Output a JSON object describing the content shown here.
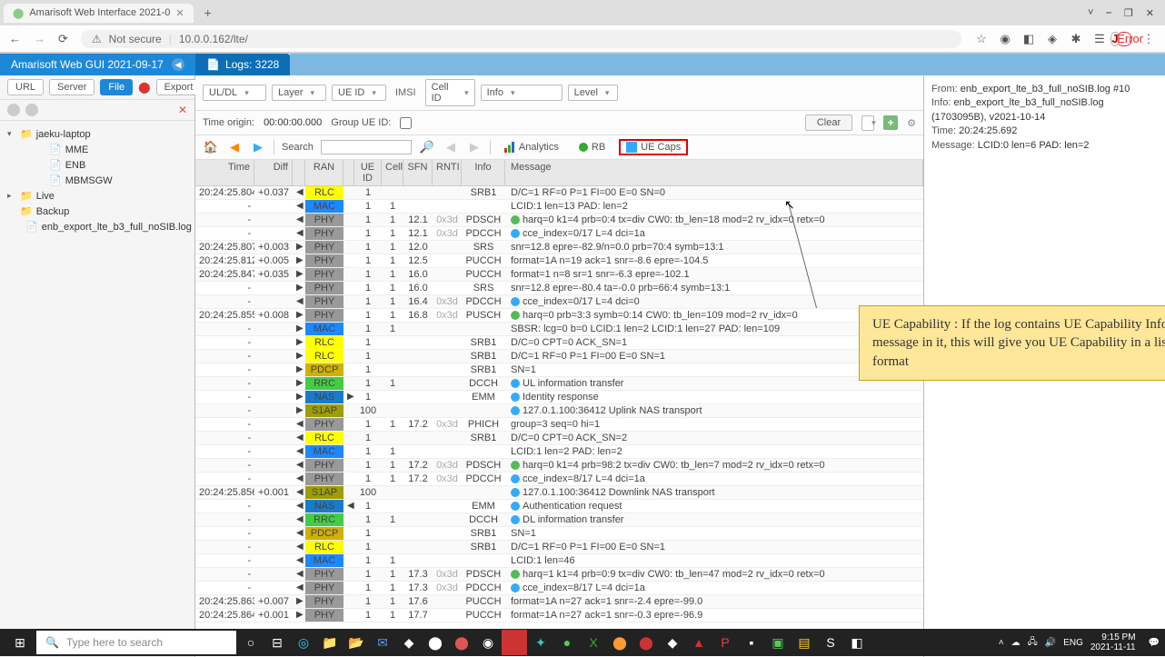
{
  "browser": {
    "tab_title": "Amarisoft Web Interface 2021-0",
    "not_secure": "Not secure",
    "url": "10.0.0.162/lte/",
    "error_label": "Error",
    "win": {
      "min": "⎯",
      "max": "❐",
      "close": "✕",
      "down": "˅"
    }
  },
  "app": {
    "title": "Amarisoft Web GUI 2021-09-17",
    "logs_tab": "Logs: 3228"
  },
  "sidebar": {
    "btns": {
      "url": "URL",
      "server": "Server",
      "file": "File",
      "export": "Export"
    },
    "tree": [
      {
        "toggle": "▾",
        "label": "jaeku-laptop",
        "indent": 0,
        "icon": "folder"
      },
      {
        "toggle": "",
        "label": "MME",
        "indent": 2,
        "icon": "file"
      },
      {
        "toggle": "",
        "label": "ENB",
        "indent": 2,
        "icon": "file"
      },
      {
        "toggle": "",
        "label": "MBMSGW",
        "indent": 2,
        "icon": "file"
      },
      {
        "toggle": "▸",
        "label": "Live",
        "indent": 0,
        "icon": "folder"
      },
      {
        "toggle": "",
        "label": "Backup",
        "indent": 0,
        "icon": "folder"
      },
      {
        "toggle": "",
        "label": "enb_export_lte_b3_full_noSIB.log",
        "indent": 1,
        "icon": "file",
        "check": true
      }
    ]
  },
  "filters": {
    "uldl": "UL/DL",
    "layer": "Layer",
    "ueid": "UE ID",
    "imsi": "IMSI",
    "cellid": "Cell ID",
    "info": "Info",
    "level": "Level",
    "time_origin_lbl": "Time origin:",
    "time_origin_val": "00:00:00.000",
    "group_lbl": "Group UE ID:",
    "clear": "Clear",
    "search_lbl": "Search",
    "analytics_lbl": "Analytics",
    "rb_lbl": "RB",
    "uecaps_lbl": "UE Caps"
  },
  "columns": {
    "time": "Time",
    "diff": "Diff",
    "ran": "RAN",
    "ueid": "UE ID",
    "cell": "Cell",
    "sfn": "SFN",
    "rnti": "RNTI",
    "info": "Info",
    "msg": "Message"
  },
  "rows": [
    {
      "time": "20:24:25.804",
      "diff": "+0.037",
      "dir": "◀",
      "ran": "RLC",
      "ueid": "1",
      "cell": "",
      "sfn": "",
      "rnti": "",
      "info": "SRB1",
      "msg": "D/C=1 RF=0 P=1 FI=00 E=0 SN=0"
    },
    {
      "time": "-",
      "diff": "",
      "dir": "◀",
      "ran": "MAC",
      "ueid": "1",
      "cell": "1",
      "sfn": "",
      "rnti": "",
      "info": "",
      "msg": "LCID:1 len=13 PAD: len=2"
    },
    {
      "time": "-",
      "diff": "",
      "dir": "◀",
      "ran": "PHY",
      "ueid": "1",
      "cell": "1",
      "sfn": "12.1",
      "rnti": "0x3d",
      "info": "PDSCH",
      "msg": "harq=0 k1=4 prb=0:4 tx=div CW0: tb_len=18 mod=2 rv_idx=0 retx=0",
      "dot": "green"
    },
    {
      "time": "-",
      "diff": "",
      "dir": "◀",
      "ran": "PHY",
      "ueid": "1",
      "cell": "1",
      "sfn": "12.1",
      "rnti": "0x3d",
      "info": "PDCCH",
      "msg": "cce_index=0/17 L=4 dci=1a",
      "dot": "blue"
    },
    {
      "time": "20:24:25.807",
      "diff": "+0.003",
      "dir": "▶",
      "ran": "PHY",
      "ueid": "1",
      "cell": "1",
      "sfn": "12.0",
      "rnti": "",
      "info": "SRS",
      "msg": "snr=12.8 epre=-82.9/n=0.0 prb=70:4 symb=13:1"
    },
    {
      "time": "20:24:25.812",
      "diff": "+0.005",
      "dir": "▶",
      "ran": "PHY",
      "ueid": "1",
      "cell": "1",
      "sfn": "12.5",
      "rnti": "",
      "info": "PUCCH",
      "msg": "format=1A n=19 ack=1 snr=-8.6 epre=-104.5"
    },
    {
      "time": "20:24:25.847",
      "diff": "+0.035",
      "dir": "▶",
      "ran": "PHY",
      "ueid": "1",
      "cell": "1",
      "sfn": "16.0",
      "rnti": "",
      "info": "PUCCH",
      "msg": "format=1 n=8 sr=1 snr=-6.3 epre=-102.1"
    },
    {
      "time": "-",
      "diff": "",
      "dir": "▶",
      "ran": "PHY",
      "ueid": "1",
      "cell": "1",
      "sfn": "16.0",
      "rnti": "",
      "info": "SRS",
      "msg": "snr=12.8 epre=-80.4 ta=-0.0 prb=66:4 symb=13:1"
    },
    {
      "time": "-",
      "diff": "",
      "dir": "◀",
      "ran": "PHY",
      "ueid": "1",
      "cell": "1",
      "sfn": "16.4",
      "rnti": "0x3d",
      "info": "PDCCH",
      "msg": "cce_index=0/17 L=4 dci=0",
      "dot": "blue"
    },
    {
      "time": "20:24:25.855",
      "diff": "+0.008",
      "dir": "▶",
      "ran": "PHY",
      "ueid": "1",
      "cell": "1",
      "sfn": "16.8",
      "rnti": "0x3d",
      "info": "PUSCH",
      "msg": "harq=0 prb=3:3 symb=0:14 CW0: tb_len=109 mod=2 rv_idx=0",
      "dot": "green"
    },
    {
      "time": "-",
      "diff": "",
      "dir": "▶",
      "ran": "MAC",
      "ueid": "1",
      "cell": "1",
      "sfn": "",
      "rnti": "",
      "info": "",
      "msg": "SBSR: lcg=0 b=0 LCID:1 len=2 LCID:1 len=27 PAD: len=109"
    },
    {
      "time": "-",
      "diff": "",
      "dir": "▶",
      "ran": "RLC",
      "ueid": "1",
      "cell": "",
      "sfn": "",
      "rnti": "",
      "info": "SRB1",
      "msg": "D/C=0 CPT=0 ACK_SN=1"
    },
    {
      "time": "-",
      "diff": "",
      "dir": "▶",
      "ran": "RLC",
      "ueid": "1",
      "cell": "",
      "sfn": "",
      "rnti": "",
      "info": "SRB1",
      "msg": "D/C=1 RF=0 P=1 FI=00 E=0 SN=1"
    },
    {
      "time": "-",
      "diff": "",
      "dir": "▶",
      "ran": "PDCP",
      "ueid": "1",
      "cell": "",
      "sfn": "",
      "rnti": "",
      "info": "SRB1",
      "msg": "SN=1"
    },
    {
      "time": "-",
      "diff": "",
      "dir": "▶",
      "ran": "RRC",
      "ueid": "1",
      "cell": "1",
      "sfn": "",
      "rnti": "",
      "info": "DCCH",
      "msg": "UL information transfer",
      "dot": "blue"
    },
    {
      "time": "-",
      "diff": "",
      "dir": "▶",
      "ran": "NAS",
      "dir2": "▶",
      "ueid": "1",
      "cell": "",
      "sfn": "",
      "rnti": "",
      "info": "EMM",
      "msg": "Identity response",
      "dot": "blue"
    },
    {
      "time": "-",
      "diff": "",
      "dir": "▶",
      "ran": "S1AP",
      "ueid": "100",
      "cell": "",
      "sfn": "",
      "rnti": "",
      "info": "",
      "msg": "127.0.1.100:36412 Uplink NAS transport",
      "dot": "blue"
    },
    {
      "time": "-",
      "diff": "",
      "dir": "◀",
      "ran": "PHY",
      "ueid": "1",
      "cell": "1",
      "sfn": "17.2",
      "rnti": "0x3d",
      "info": "PHICH",
      "msg": "group=3 seq=0 hi=1"
    },
    {
      "time": "-",
      "diff": "",
      "dir": "◀",
      "ran": "RLC",
      "ueid": "1",
      "cell": "",
      "sfn": "",
      "rnti": "",
      "info": "SRB1",
      "msg": "D/C=0 CPT=0 ACK_SN=2"
    },
    {
      "time": "-",
      "diff": "",
      "dir": "◀",
      "ran": "MAC",
      "ueid": "1",
      "cell": "1",
      "sfn": "",
      "rnti": "",
      "info": "",
      "msg": "LCID:1 len=2 PAD: len=2"
    },
    {
      "time": "-",
      "diff": "",
      "dir": "◀",
      "ran": "PHY",
      "ueid": "1",
      "cell": "1",
      "sfn": "17.2",
      "rnti": "0x3d",
      "info": "PDSCH",
      "msg": "harq=0 k1=4 prb=98:2 tx=div CW0: tb_len=7 mod=2 rv_idx=0 retx=0",
      "dot": "green"
    },
    {
      "time": "-",
      "diff": "",
      "dir": "◀",
      "ran": "PHY",
      "ueid": "1",
      "cell": "1",
      "sfn": "17.2",
      "rnti": "0x3d",
      "info": "PDCCH",
      "msg": "cce_index=8/17 L=4 dci=1a",
      "dot": "blue"
    },
    {
      "time": "20:24:25.856",
      "diff": "+0.001",
      "dir": "◀",
      "ran": "S1AP",
      "ueid": "100",
      "cell": "",
      "sfn": "",
      "rnti": "",
      "info": "",
      "msg": "127.0.1.100:36412 Downlink NAS transport",
      "dot": "blue"
    },
    {
      "time": "-",
      "diff": "",
      "dir": "◀",
      "ran": "NAS",
      "dir2": "◀",
      "ueid": "1",
      "cell": "",
      "sfn": "",
      "rnti": "",
      "info": "EMM",
      "msg": "Authentication request",
      "dot": "blue"
    },
    {
      "time": "-",
      "diff": "",
      "dir": "◀",
      "ran": "RRC",
      "ueid": "1",
      "cell": "1",
      "sfn": "",
      "rnti": "",
      "info": "DCCH",
      "msg": "DL information transfer",
      "dot": "blue"
    },
    {
      "time": "-",
      "diff": "",
      "dir": "◀",
      "ran": "PDCP",
      "ueid": "1",
      "cell": "",
      "sfn": "",
      "rnti": "",
      "info": "SRB1",
      "msg": "SN=1"
    },
    {
      "time": "-",
      "diff": "",
      "dir": "◀",
      "ran": "RLC",
      "ueid": "1",
      "cell": "",
      "sfn": "",
      "rnti": "",
      "info": "SRB1",
      "msg": "D/C=1 RF=0 P=1 FI=00 E=0 SN=1"
    },
    {
      "time": "-",
      "diff": "",
      "dir": "◀",
      "ran": "MAC",
      "ueid": "1",
      "cell": "1",
      "sfn": "",
      "rnti": "",
      "info": "",
      "msg": "LCID:1 len=46"
    },
    {
      "time": "-",
      "diff": "",
      "dir": "◀",
      "ran": "PHY",
      "ueid": "1",
      "cell": "1",
      "sfn": "17.3",
      "rnti": "0x3d",
      "info": "PDSCH",
      "msg": "harq=1 k1=4 prb=0:9 tx=div CW0: tb_len=47 mod=2 rv_idx=0 retx=0",
      "dot": "green"
    },
    {
      "time": "-",
      "diff": "",
      "dir": "◀",
      "ran": "PHY",
      "ueid": "1",
      "cell": "1",
      "sfn": "17.3",
      "rnti": "0x3d",
      "info": "PDCCH",
      "msg": "cce_index=8/17 L=4 dci=1a",
      "dot": "blue"
    },
    {
      "time": "20:24:25.863",
      "diff": "+0.007",
      "dir": "▶",
      "ran": "PHY",
      "ueid": "1",
      "cell": "1",
      "sfn": "17.6",
      "rnti": "",
      "info": "PUCCH",
      "msg": "format=1A n=27 ack=1 snr=-2.4 epre=-99.0"
    },
    {
      "time": "20:24:25.864",
      "diff": "+0.001",
      "dir": "▶",
      "ran": "PHY",
      "ueid": "1",
      "cell": "1",
      "sfn": "17.7",
      "rnti": "",
      "info": "PUCCH",
      "msg": "format=1A n=27 ack=1 snr=-0.3 epre=-96.9"
    }
  ],
  "detail": {
    "from_lbl": "From:",
    "from_val": "enb_export_lte_b3_full_noSIB.log #10",
    "info_lbl": "Info:",
    "info_val": "enb_export_lte_b3_full_noSIB.log (1703095B), v2021-10-14",
    "time_lbl": "Time:",
    "time_val": "20:24:25.692",
    "msg_lbl": "Message:",
    "msg_val": "LCID:0 len=6 PAD: len=2"
  },
  "tooltip": "UE Capability : If the log contains UE Capability Info message in it, this will give you UE Capability in a list format",
  "taskbar": {
    "search_placeholder": "Type here to search",
    "time": "9:15 PM",
    "date": "2021-11-11"
  }
}
